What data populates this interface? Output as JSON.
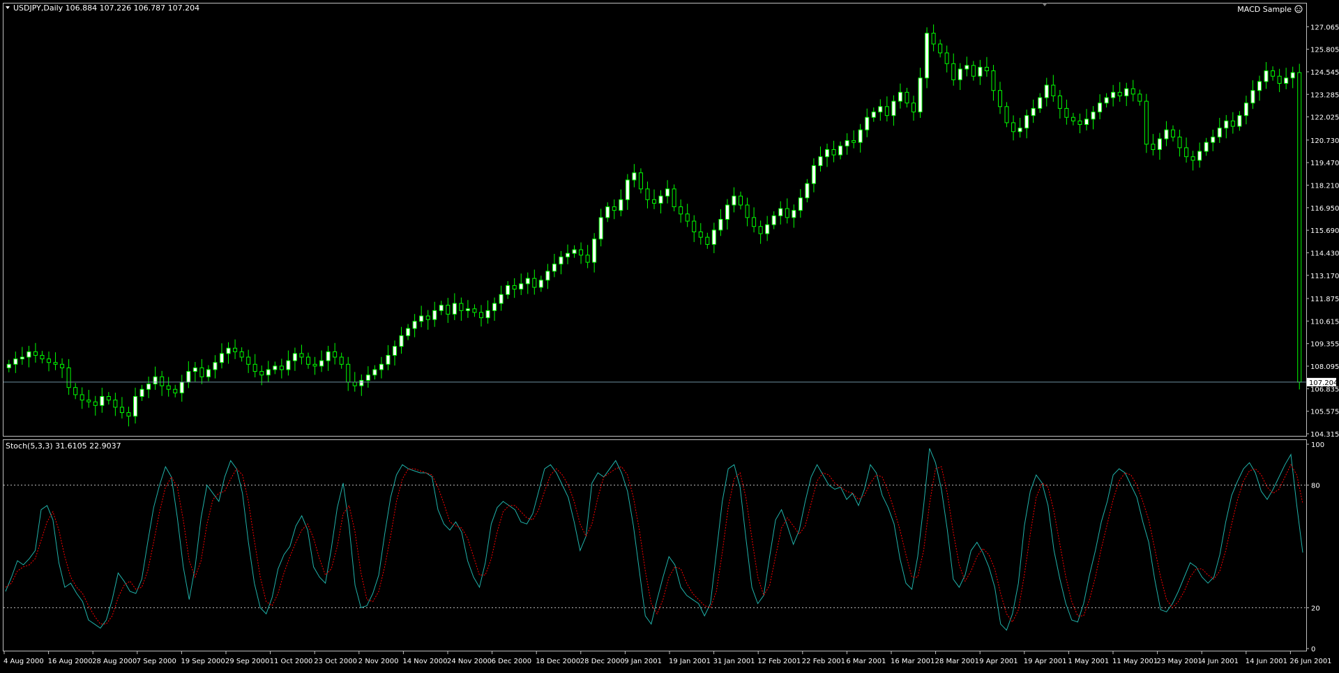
{
  "header": {
    "symbol_line": "USDJPY,Daily  106.884 107.226 106.787 107.204",
    "expert_label": "MACD Sample",
    "expert_icon": "smiley-icon"
  },
  "price_panel": {
    "ticks": [
      "127.065",
      "125.805",
      "124.545",
      "123.285",
      "122.025",
      "120.730",
      "119.470",
      "118.210",
      "116.950",
      "115.690",
      "114.430",
      "113.170",
      "111.875",
      "110.615",
      "109.355",
      "108.095",
      "106.835",
      "105.575",
      "104.315"
    ],
    "ylim": [
      104.315,
      127.7
    ],
    "current_price": 107.204,
    "current_price_label": "107.204",
    "current_line_color": "#6e8fa0"
  },
  "stoch_panel": {
    "label": "Stoch(5,3,3) 31.6105 22.9037",
    "ticks": [
      "100",
      "80",
      "20",
      "0"
    ],
    "levels": [
      80,
      20
    ]
  },
  "dates": [
    "4 Aug 2000",
    "16 Aug 2000",
    "28 Aug 2000",
    "7 Sep 2000",
    "19 Sep 2000",
    "29 Sep 2000",
    "11 Oct 2000",
    "23 Oct 2000",
    "2 Nov 2000",
    "14 Nov 2000",
    "24 Nov 2000",
    "6 Dec 2000",
    "18 Dec 2000",
    "28 Dec 2000",
    "9 Jan 2001",
    "19 Jan 2001",
    "31 Jan 2001",
    "12 Feb 2001",
    "22 Feb 2001",
    "6 Mar 2001",
    "16 Mar 2001",
    "28 Mar 2001",
    "9 Apr 2001",
    "19 Apr 2001",
    "1 May 2001",
    "11 May 2001",
    "23 May 2001",
    "4 Jun 2001",
    "14 Jun 2001",
    "26 Jun 2001"
  ],
  "colors": {
    "bull_candle": "#ffffff",
    "bear_candle": "#000000",
    "wick": "#00ff00",
    "stoch_main": "#20b2aa",
    "stoch_signal": "#ff0000",
    "grid_frame": "#c0c0c0"
  },
  "chart_data": [
    {
      "type": "candlestick",
      "title": "USDJPY,Daily",
      "x_start": "4 Aug 2000",
      "x_end": "26 Jun 2001",
      "ylim": [
        104.315,
        127.7
      ],
      "close": [
        108.2,
        108.5,
        108.6,
        108.9,
        108.7,
        108.5,
        108.3,
        108.2,
        108.0,
        106.9,
        106.5,
        106.2,
        106.1,
        105.9,
        106.4,
        106.2,
        105.8,
        105.5,
        105.3,
        106.4,
        106.8,
        107.1,
        107.5,
        107.0,
        106.8,
        106.6,
        107.2,
        107.8,
        108.0,
        107.5,
        107.9,
        108.3,
        108.8,
        109.1,
        108.9,
        108.6,
        108.2,
        107.8,
        107.6,
        107.9,
        108.1,
        107.9,
        108.4,
        108.8,
        108.6,
        108.2,
        108.1,
        108.4,
        108.9,
        108.6,
        108.2,
        107.2,
        107.0,
        107.3,
        107.6,
        107.9,
        108.2,
        108.7,
        109.2,
        109.8,
        110.2,
        110.6,
        110.9,
        110.7,
        111.2,
        111.5,
        111.0,
        111.6,
        111.2,
        111.3,
        111.1,
        110.8,
        111.2,
        111.6,
        112.1,
        112.6,
        112.4,
        112.7,
        113.0,
        112.5,
        112.9,
        113.4,
        113.8,
        114.2,
        114.4,
        114.6,
        114.3,
        113.9,
        115.2,
        116.4,
        117.0,
        116.8,
        117.4,
        118.5,
        118.9,
        118.0,
        117.4,
        117.2,
        117.6,
        118.0,
        117.0,
        116.6,
        116.2,
        115.6,
        115.3,
        114.9,
        115.7,
        116.3,
        117.1,
        117.6,
        117.1,
        116.4,
        115.9,
        115.5,
        116.0,
        116.5,
        116.9,
        116.4,
        116.8,
        117.5,
        118.3,
        119.3,
        119.8,
        120.2,
        119.9,
        120.4,
        120.7,
        120.6,
        121.3,
        122.0,
        122.3,
        122.6,
        122.1,
        122.9,
        123.4,
        122.8,
        122.3,
        124.2,
        126.7,
        126.1,
        125.6,
        125.0,
        124.1,
        124.7,
        124.9,
        124.3,
        124.8,
        124.6,
        123.5,
        122.6,
        121.7,
        121.2,
        121.4,
        122.1,
        122.5,
        123.1,
        123.8,
        123.2,
        122.5,
        122.0,
        121.8,
        121.6,
        121.9,
        122.3,
        122.8,
        123.1,
        123.4,
        123.2,
        123.6,
        123.3,
        122.9,
        120.5,
        120.2,
        120.8,
        121.3,
        120.9,
        120.3,
        119.8,
        119.6,
        120.1,
        120.6,
        120.9,
        121.4,
        121.8,
        121.5,
        122.1,
        122.8,
        123.5,
        124.0,
        124.6,
        124.3,
        123.9,
        124.2,
        124.5,
        107.204
      ]
    },
    {
      "type": "line",
      "title": "Stoch(5,3,3) 31.6105 22.9037",
      "ylim": [
        0,
        100
      ],
      "series": [
        {
          "name": "Stoch(5,3,3)",
          "values": [
            28,
            35,
            43,
            41,
            44,
            48,
            68,
            70,
            63,
            42,
            30,
            32,
            27,
            23,
            14,
            12,
            10,
            14,
            24,
            37,
            33,
            28,
            27,
            34,
            52,
            69,
            80,
            89,
            84,
            64,
            40,
            24,
            40,
            64,
            80,
            76,
            72,
            84,
            92,
            88,
            76,
            52,
            32,
            20,
            17,
            25,
            39,
            46,
            50,
            60,
            65,
            58,
            40,
            35,
            32,
            49,
            69,
            81,
            60,
            31,
            20,
            21,
            27,
            36,
            56,
            74,
            85,
            90,
            88,
            87,
            86,
            86,
            84,
            68,
            61,
            58,
            62,
            57,
            43,
            35,
            30,
            42,
            61,
            69,
            72,
            70,
            68,
            62,
            61,
            66,
            77,
            88,
            90,
            86,
            80,
            74,
            62,
            48,
            55,
            81,
            86,
            84,
            88,
            92,
            86,
            77,
            60,
            38,
            16,
            12,
            24,
            35,
            45,
            41,
            30,
            26,
            24,
            22,
            16,
            22,
            47,
            72,
            88,
            90,
            79,
            54,
            30,
            22,
            26,
            45,
            63,
            68,
            60,
            51,
            58,
            72,
            84,
            90,
            85,
            80,
            78,
            79,
            73,
            76,
            70,
            78,
            90,
            86,
            75,
            69,
            61,
            44,
            32,
            29,
            45,
            70,
            98,
            91,
            78,
            58,
            34,
            30,
            36,
            48,
            52,
            47,
            40,
            30,
            12,
            9,
            17,
            32,
            60,
            77,
            85,
            81,
            70,
            48,
            34,
            22,
            14,
            13,
            22,
            36,
            48,
            62,
            72,
            85,
            88,
            86,
            80,
            74,
            62,
            52,
            34,
            19,
            18,
            22,
            28,
            35,
            42,
            40,
            35,
            32,
            35,
            46,
            62,
            75,
            82,
            88,
            91,
            86,
            77,
            73,
            78,
            84,
            90,
            95,
            70,
            47
          ]
        },
        {
          "name": "Signal",
          "values": [
            30,
            32,
            38,
            40,
            41,
            44,
            53,
            62,
            67,
            58,
            45,
            35,
            30,
            27,
            21,
            16,
            12,
            12,
            16,
            25,
            31,
            33,
            29,
            30,
            38,
            52,
            67,
            79,
            84,
            79,
            63,
            43,
            35,
            43,
            61,
            73,
            76,
            77,
            83,
            88,
            85,
            72,
            53,
            35,
            23,
            21,
            27,
            37,
            45,
            52,
            58,
            61,
            54,
            44,
            36,
            39,
            50,
            66,
            70,
            57,
            37,
            24,
            23,
            28,
            40,
            55,
            72,
            83,
            88,
            88,
            87,
            86,
            85,
            79,
            71,
            62,
            60,
            59,
            54,
            45,
            36,
            36,
            44,
            57,
            67,
            70,
            70,
            67,
            64,
            63,
            68,
            77,
            85,
            88,
            85,
            80,
            72,
            61,
            55,
            61,
            74,
            84,
            86,
            88,
            89,
            85,
            74,
            58,
            38,
            22,
            17,
            24,
            35,
            40,
            39,
            32,
            27,
            24,
            21,
            20,
            28,
            47,
            69,
            83,
            86,
            74,
            54,
            35,
            26,
            31,
            45,
            59,
            64,
            60,
            56,
            60,
            71,
            82,
            86,
            85,
            81,
            79,
            77,
            76,
            73,
            75,
            81,
            85,
            84,
            77,
            68,
            58,
            46,
            35,
            35,
            48,
            71,
            88,
            89,
            76,
            57,
            41,
            33,
            38,
            45,
            49,
            46,
            39,
            27,
            17,
            13,
            19,
            36,
            56,
            74,
            81,
            79,
            67,
            51,
            35,
            23,
            16,
            16,
            24,
            35,
            49,
            61,
            73,
            82,
            86,
            85,
            80,
            72,
            63,
            49,
            35,
            24,
            20,
            23,
            28,
            35,
            39,
            39,
            36,
            34,
            38,
            48,
            61,
            73,
            82,
            87,
            88,
            85,
            79,
            76,
            78,
            84,
            90,
            85,
            71
          ]
        }
      ]
    }
  ]
}
